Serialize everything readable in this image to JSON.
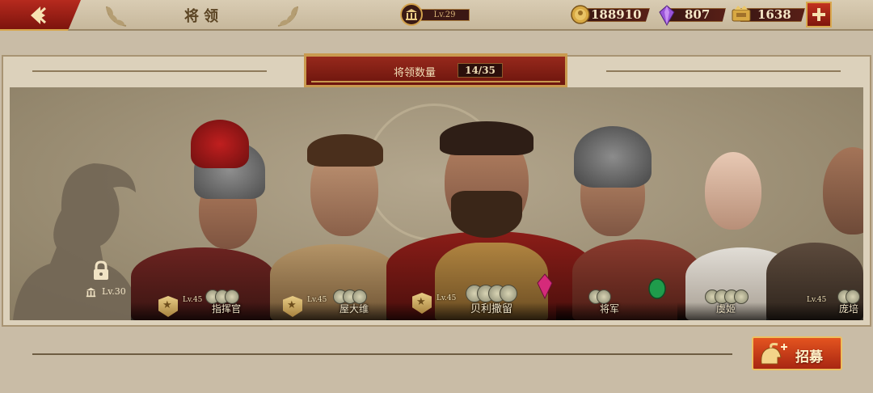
{
  "header": {
    "title": "将领",
    "player_level": "Lv.29"
  },
  "resources": {
    "gold": "188910",
    "gems": "807",
    "tickets": "1638"
  },
  "panel": {
    "count_label": "将领数量",
    "count_value": "14/35"
  },
  "locked_slot": {
    "unlock_level": "Lv.30"
  },
  "heroes": [
    {
      "name": "指挥官",
      "level": "Lv.45"
    },
    {
      "name": "屋大维",
      "level": "Lv.45"
    },
    {
      "name": "贝利撒留",
      "level": "Lv.45"
    },
    {
      "name": "将军",
      "level": ""
    },
    {
      "name": "虞姬",
      "level": ""
    },
    {
      "name": "庞培",
      "level": "Lv.45"
    }
  ],
  "actions": {
    "recruit_label": "招募"
  },
  "colors": {
    "accent_red": "#8f2216",
    "gold_trim": "#d2a14c",
    "parchment": "#c9bca6"
  },
  "icons": [
    "back-arrow-icon",
    "laurel-icon",
    "temple-icon",
    "coin-icon",
    "gem-icon",
    "ticket-icon",
    "plus-icon",
    "lock-icon",
    "rank-star-icon",
    "helmet-icon"
  ]
}
